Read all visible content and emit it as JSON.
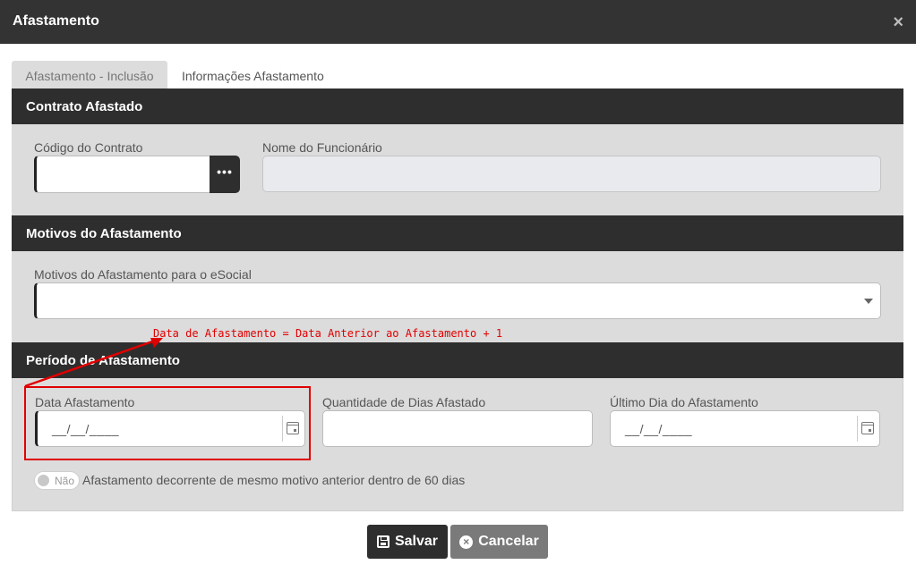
{
  "dialog": {
    "title": "Afastamento",
    "close_glyph": "×"
  },
  "tabs": [
    {
      "label": "Afastamento - Inclusão",
      "active": true
    },
    {
      "label": "Informações Afastamento",
      "active": false
    }
  ],
  "contrato": {
    "heading": "Contrato Afastado",
    "codigo_label": "Código do Contrato",
    "codigo_value": "",
    "lookup_glyph": "•••",
    "nome_label": "Nome do Funcionário",
    "nome_value": ""
  },
  "motivos": {
    "heading": "Motivos do Afastamento",
    "esocial_label": "Motivos do Afastamento para o eSocial",
    "esocial_value": ""
  },
  "periodo": {
    "heading": "Período de Afastamento",
    "data_label": "Data Afastamento",
    "data_mask": "__/__/____",
    "quantidade_label": "Quantidade de Dias Afastado",
    "quantidade_value": "",
    "ultimo_label": "Último Dia do Afastamento",
    "ultimo_mask": "__/__/____",
    "toggle_text": "Não",
    "toggle_caption": "Afastamento decorrente de mesmo motivo anterior dentro de 60 dias"
  },
  "annotation": {
    "text": "Data de Afastamento = Data Anterior ao Afastamento + 1",
    "color": "#e00000"
  },
  "actions": {
    "save_label": "Salvar",
    "cancel_label": "Cancelar"
  },
  "colors": {
    "header": "#333333",
    "section": "#2e2e2e",
    "panel": "#dcdcdc",
    "cancel": "#7a7a7a"
  }
}
